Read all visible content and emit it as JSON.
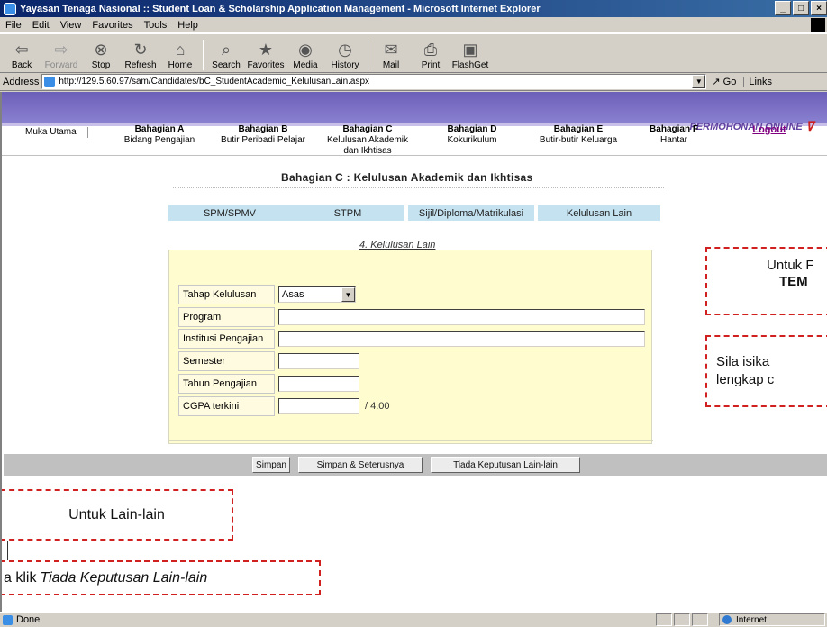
{
  "window": {
    "title": "Yayasan Tenaga Nasional :: Student Loan & Scholarship Application Management - Microsoft Internet Explorer",
    "min_label": "_",
    "max_label": "□",
    "close_label": "×"
  },
  "menu": [
    "File",
    "Edit",
    "View",
    "Favorites",
    "Tools",
    "Help"
  ],
  "toolbar": {
    "back": "Back",
    "forward": "Forward",
    "stop": "Stop",
    "refresh": "Refresh",
    "home": "Home",
    "search": "Search",
    "favorites": "Favorites",
    "media": "Media",
    "history": "History",
    "mail": "Mail",
    "print": "Print",
    "flashget": "FlashGet"
  },
  "address": {
    "label": "Address",
    "url": "http://129.5.60.97/sam/Candidates/bC_StudentAcademic_KelulusanLain.aspx",
    "go": "Go",
    "links": "Links"
  },
  "banner": {
    "logo_text": "PERMOHONAN ONLINE"
  },
  "nav": {
    "home": "Muka Utama",
    "a_title": "Bahagian A",
    "a_sub": "Bidang Pengajian",
    "b_title": "Bahagian B",
    "b_sub": "Butir Peribadi Pelajar",
    "c_title": "Bahagian C",
    "c_sub": "Kelulusan Akademik",
    "c_sub2": "dan Ikhtisas",
    "d_title": "Bahagian D",
    "d_sub": "Kokurikulum",
    "e_title": "Bahagian E",
    "e_sub": "Butir-butir Keluarga",
    "f_title": "Bahagian F",
    "f_sub": "Hantar",
    "logout": "Logout"
  },
  "section": {
    "title": "Bahagian C : Kelulusan Akademik dan Ikhtisas",
    "tabs": [
      "SPM/SPMV",
      "STPM",
      "Sijil/Diploma/Matrikulasi",
      "Kelulusan Lain"
    ],
    "sub_link": "4. Kelulusan Lain"
  },
  "form": {
    "tahap_label": "Tahap Kelulusan",
    "tahap_value": "Asas",
    "program_label": "Program",
    "program_value": "",
    "institusi_label": "Institusi Pengajian",
    "institusi_value": "",
    "semester_label": "Semester",
    "semester_value": "",
    "tahun_label": "Tahun Pengajian",
    "tahun_value": "",
    "cgpa_label": "CGPA terkini",
    "cgpa_value": "",
    "cgpa_suffix": "/ 4.00"
  },
  "actions": {
    "simpan": "Simpan",
    "simpan_seterusnya": "Simpan & Seterusnya",
    "tiada": "Tiada Keputusan Lain-lain"
  },
  "callouts": {
    "lain": "Untuk Lain-lain",
    "tiada_prefix": "a klik",
    "tiada_em": "Tiada Keputusan Lain-lain",
    "untuk_line1": "Untuk F",
    "untuk_line2": "TEM",
    "sila_line1": "Sila isika",
    "sila_line2": "lengkap c"
  },
  "status": {
    "done": "Done",
    "zone": "Internet"
  }
}
